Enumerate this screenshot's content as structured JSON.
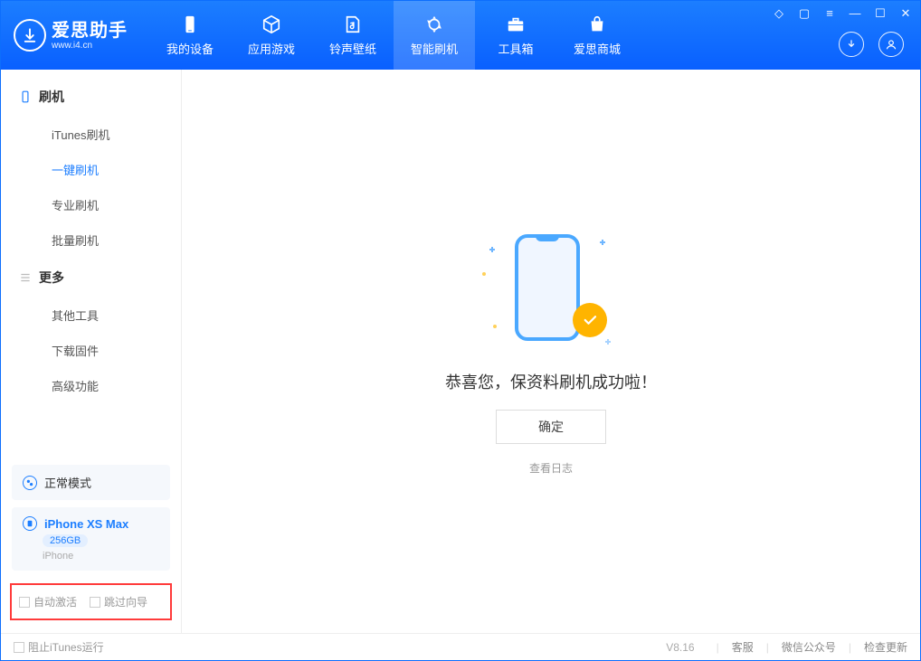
{
  "app": {
    "title": "爱思助手",
    "subtitle": "www.i4.cn"
  },
  "tabs": {
    "device": "我的设备",
    "apps": "应用游戏",
    "ringtone": "铃声壁纸",
    "flash": "智能刷机",
    "toolbox": "工具箱",
    "store": "爱思商城"
  },
  "sidebar": {
    "flash_header": "刷机",
    "items": {
      "itunes": "iTunes刷机",
      "onekey": "一键刷机",
      "pro": "专业刷机",
      "batch": "批量刷机"
    },
    "more_header": "更多",
    "more_items": {
      "other": "其他工具",
      "download": "下载固件",
      "advanced": "高级功能"
    }
  },
  "status": {
    "mode": "正常模式",
    "device_name": "iPhone XS Max",
    "storage": "256GB",
    "device_type": "iPhone"
  },
  "options": {
    "auto_activate": "自动激活",
    "skip_guide": "跳过向导"
  },
  "main": {
    "message": "恭喜您，保资料刷机成功啦！",
    "ok": "确定",
    "view_log": "查看日志"
  },
  "footer": {
    "block_itunes": "阻止iTunes运行",
    "version": "V8.16",
    "support": "客服",
    "wechat": "微信公众号",
    "update": "检查更新"
  }
}
